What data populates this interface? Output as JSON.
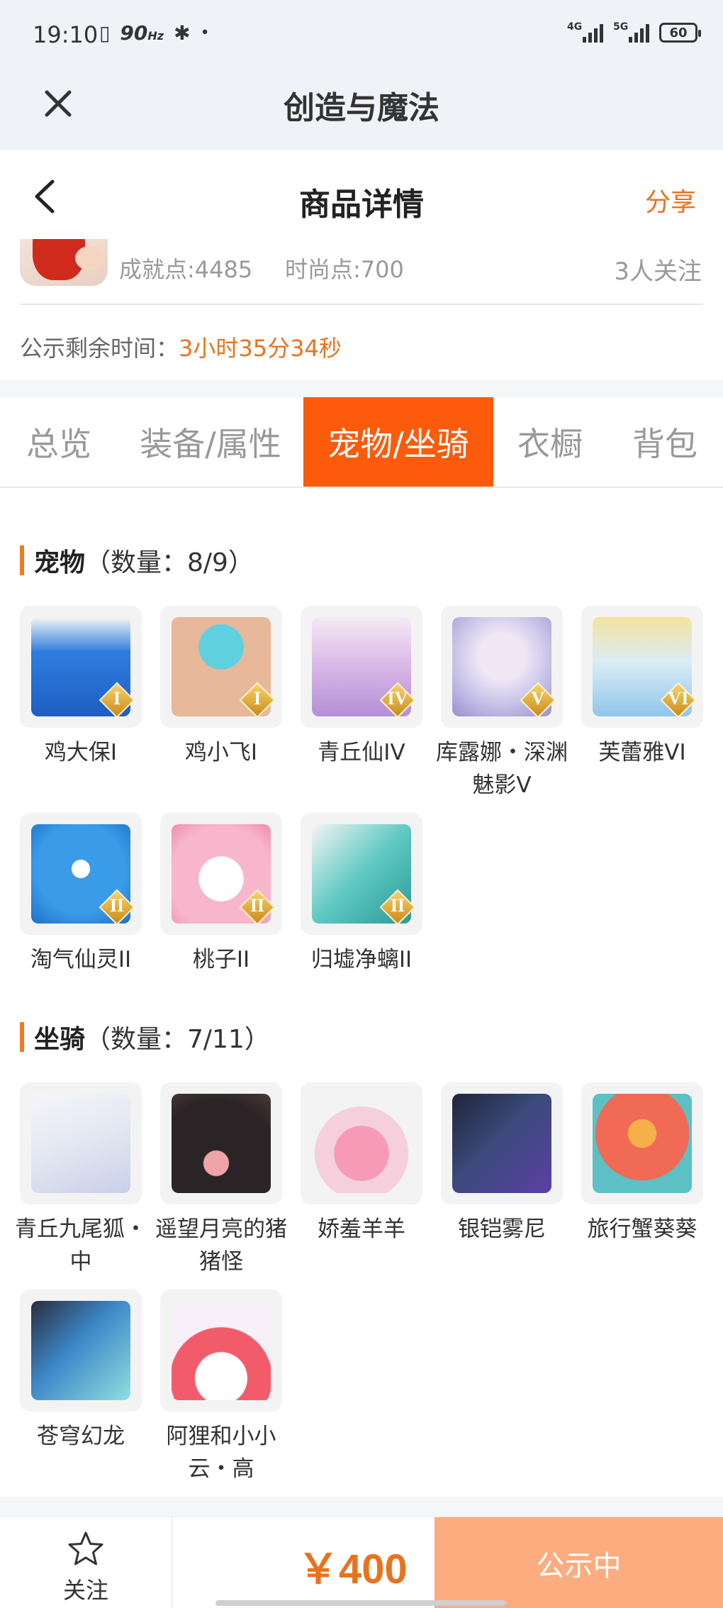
{
  "status_bar": {
    "time": "19:10",
    "refresh": "90",
    "refresh_unit": "Hz",
    "network1": "4G",
    "network2": "5G",
    "battery": "60"
  },
  "app": {
    "title": "创造与魔法"
  },
  "page": {
    "title": "商品详情",
    "share_label": "分享"
  },
  "profile": {
    "achievement": "成就点:4485",
    "fashion": "时尚点:700",
    "followers": "3人关注"
  },
  "countdown": {
    "label": "公示剩余时间：",
    "value": "3小时35分34秒"
  },
  "tabs": [
    {
      "label": "总览"
    },
    {
      "label": "装备/属性"
    },
    {
      "label": "宠物/坐骑"
    },
    {
      "label": "衣橱"
    },
    {
      "label": "背包"
    }
  ],
  "active_tab": "宠物/坐骑",
  "pets": {
    "title": "宠物",
    "count": "（数量：8/9）",
    "items": [
      {
        "name": "鸡大保I",
        "rank": "I",
        "icon": "blue-bird-sunglasses"
      },
      {
        "name": "鸡小飞I",
        "rank": "I",
        "icon": "muscle-bird"
      },
      {
        "name": "青丘仙IV",
        "rank": "IV",
        "icon": "fox-fairy"
      },
      {
        "name": "库露娜・深渊魅影V",
        "rank": "V",
        "icon": "white-hair-girl"
      },
      {
        "name": "芙蕾雅VI",
        "rank": "VI",
        "icon": "valkyrie-girl"
      },
      {
        "name": "淘气仙灵II",
        "rank": "II",
        "icon": "blue-dog"
      },
      {
        "name": "桃子II",
        "rank": "II",
        "icon": "pink-bunny"
      },
      {
        "name": "归墟净螭II",
        "rank": "II",
        "icon": "teal-dragon"
      }
    ]
  },
  "mounts": {
    "title": "坐骑",
    "count": "（数量：7/11）",
    "items": [
      {
        "name": "青丘九尾狐・中",
        "icon": "white-fox"
      },
      {
        "name": "遥望月亮的猪猪怪",
        "icon": "black-pig"
      },
      {
        "name": "娇羞羊羊",
        "icon": "pink-sheep"
      },
      {
        "name": "银铠雾尼",
        "icon": "armored-dragon"
      },
      {
        "name": "旅行蟹葵葵",
        "icon": "crab"
      },
      {
        "name": "苍穹幻龙",
        "icon": "sky-dragon"
      },
      {
        "name": "阿狸和小小云・高",
        "icon": "fox-on-cloud"
      }
    ]
  },
  "bottom": {
    "follow_label": "关注",
    "price": "￥400",
    "status_button": "公示中"
  },
  "colors": {
    "accent": "#fb5b0b",
    "orange_text": "#e8731f",
    "status_button": "#fcac7e"
  }
}
